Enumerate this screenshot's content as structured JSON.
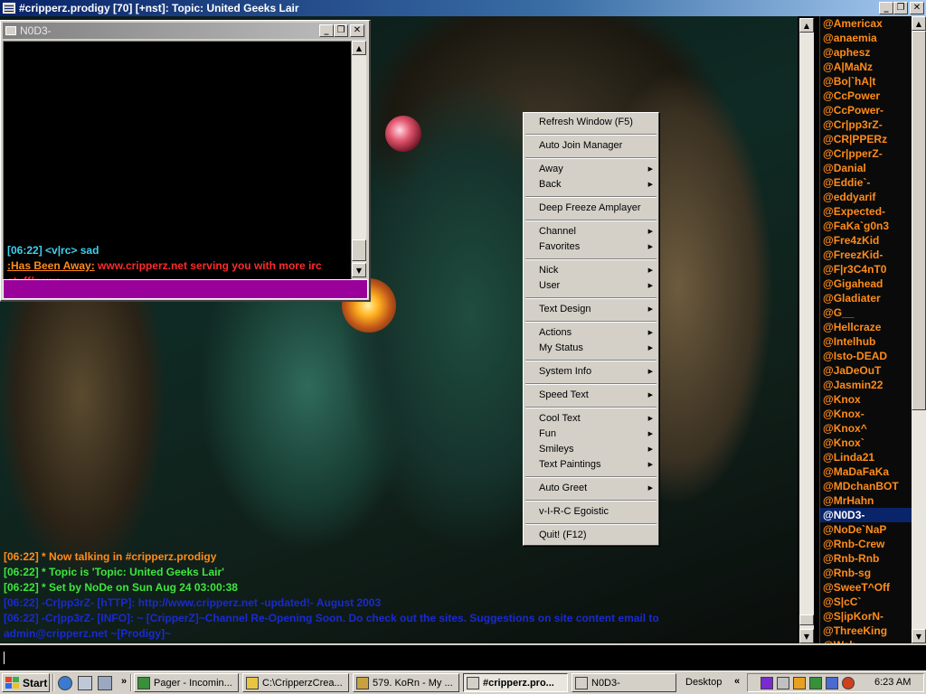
{
  "window": {
    "title": "#cripperz.prodigy [70] [+nst]: Topic: United Geeks Lair",
    "minimize": "_",
    "restore": "❐",
    "close": "✕"
  },
  "query": {
    "title": "N0D3-",
    "lines": [
      {
        "text": "[06:22] <v|rc> sad",
        "color": "#3fd0f0"
      },
      {
        "label": ":Has Been Away:",
        "label_color": "#ff8c1a",
        "text": "www.cripperz.net serving you with more irc stuff/news",
        "color": "#ff2a2a"
      }
    ],
    "input_color": "#9a009a"
  },
  "context_menu": {
    "items": [
      {
        "label": "Refresh Window (F5)",
        "submenu": false
      },
      {
        "sep": true
      },
      {
        "label": "Auto Join Manager",
        "submenu": false
      },
      {
        "sep": true
      },
      {
        "label": "Away",
        "submenu": true
      },
      {
        "label": "Back",
        "submenu": true
      },
      {
        "sep": true
      },
      {
        "label": "Deep Freeze Amplayer",
        "submenu": false
      },
      {
        "sep": true
      },
      {
        "label": "Channel",
        "submenu": true
      },
      {
        "label": "Favorites",
        "submenu": true
      },
      {
        "sep": true
      },
      {
        "label": "Nick",
        "submenu": true
      },
      {
        "label": "User",
        "submenu": true
      },
      {
        "sep": true
      },
      {
        "label": "Text Design",
        "submenu": true
      },
      {
        "sep": true
      },
      {
        "label": "Actions",
        "submenu": true
      },
      {
        "label": "My Status",
        "submenu": true
      },
      {
        "sep": true
      },
      {
        "label": "System Info",
        "submenu": true
      },
      {
        "sep": true
      },
      {
        "label": "Speed Text",
        "submenu": true
      },
      {
        "sep": true
      },
      {
        "label": "Cool Text",
        "submenu": true
      },
      {
        "label": "Fun",
        "submenu": true
      },
      {
        "label": "Smileys",
        "submenu": true
      },
      {
        "label": "Text Paintings",
        "submenu": true
      },
      {
        "sep": true
      },
      {
        "label": "Auto Greet",
        "submenu": true
      },
      {
        "sep": true
      },
      {
        "label": "v-I-R-C Egoistic",
        "submenu": false
      },
      {
        "sep": true
      },
      {
        "label": "Quit! (F12)",
        "submenu": false
      }
    ],
    "arrow": "▶"
  },
  "channel": {
    "messages": [
      {
        "text": "[06:22] * Now talking in #cripperz.prodigy",
        "color": "#ff8c1a"
      },
      {
        "text": "[06:22] * Topic is 'Topic: United Geeks Lair'",
        "color": "#3fe53f"
      },
      {
        "text": "[06:22] * Set by NoDe on Sun Aug 24 03:00:38",
        "color": "#3fe53f"
      },
      {
        "text": "[06:22] -Cr|pp3rZ- [hTTP]: http://www.cripperz.net -updated!- August 2003",
        "color": "#1a2ad0"
      },
      {
        "text": "[06:22] -Cr|pp3rZ- [INFO]: ~ [CripperZ]~Channel Re-Opening Soon. Do check out the sites. Suggestions on site content email to",
        "color": "#1a2ad0"
      },
      {
        "text": "  admin@cripperz.net ~[Prodigy]~",
        "color": "#1a2ad0"
      }
    ]
  },
  "nicklist": {
    "nicks": [
      "@Americax",
      "@anaemia",
      "@aphesz",
      "@A|MaNz",
      "@Bo|`hA|t",
      "@CcPower",
      "@CcPower-",
      "@Cr|pp3rZ-",
      "@CR|PPERz",
      "@Cr|pperZ-",
      "@Danial",
      "@Eddie`-",
      "@eddyarif",
      "@Expected-",
      "@FaKa`g0n3",
      "@Fre4zKid",
      "@FreezKid-",
      "@F|r3C4nT0",
      "@Gigahead",
      "@Gladiater",
      "@G__",
      "@Hellcraze",
      "@Intelhub",
      "@Isto-DEAD",
      "@JaDeOuT",
      "@Jasmin22",
      "@Knox",
      "@Knox-",
      "@Knox^",
      "@Knox`",
      "@Linda21",
      "@MaDaFaKa",
      "@MDchanBOT",
      "@MrHahn",
      "@N0D3-",
      "@NoDe`NaP",
      "@Rnb-Crew",
      "@Rnb-Rnb",
      "@Rnb-sg",
      "@SweeT^Off",
      "@S|cC`",
      "@S|ipKorN-",
      "@ThreeKing",
      "@Wah"
    ],
    "selected": "@N0D3-",
    "color": "#ff8c1a"
  },
  "taskbar": {
    "start": "Start",
    "more_chevron": "»",
    "tasks": [
      {
        "label": "Pager - Incomin...",
        "icon_color": "#3a8f3a"
      },
      {
        "label": "C:\\CripperzCrea...",
        "icon_color": "#e8c440"
      },
      {
        "label": "579. KoRn - My ...",
        "icon_color": "#c8a040"
      },
      {
        "label": "#cripperz.pro...",
        "icon_color": "#d4d0c8",
        "active": true
      },
      {
        "label": "N0D3-",
        "icon_color": "#d4d0c8"
      }
    ],
    "desktop": "Desktop",
    "tray_chevron": "«",
    "clock": "6:23 AM"
  }
}
